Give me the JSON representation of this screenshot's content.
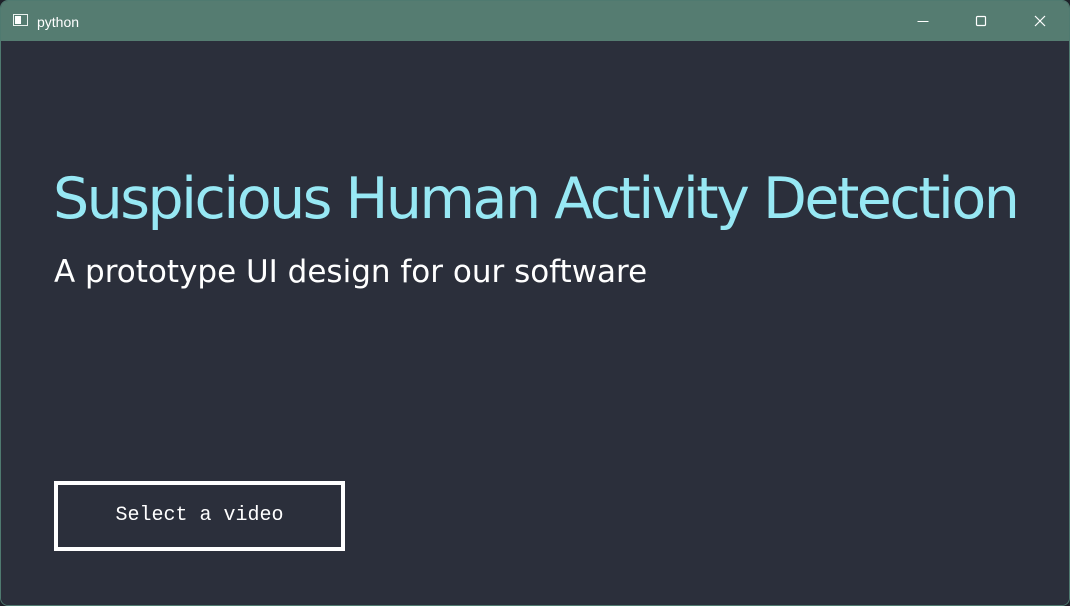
{
  "window": {
    "title": "python",
    "app_icon": "window-app-icon",
    "controls": {
      "minimize_icon": "minimize-icon",
      "maximize_icon": "maximize-icon",
      "close_icon": "close-icon"
    }
  },
  "main": {
    "title": "Suspicious Human Activity Detection",
    "subtitle": "A prototype UI design for our software",
    "select_video_label": "Select a video"
  },
  "colors": {
    "title_bar": "#557c71",
    "background": "#2b2f3b",
    "title_text": "#97e8f4",
    "subtitle_text": "#ffffff",
    "button_border": "#ffffff"
  }
}
